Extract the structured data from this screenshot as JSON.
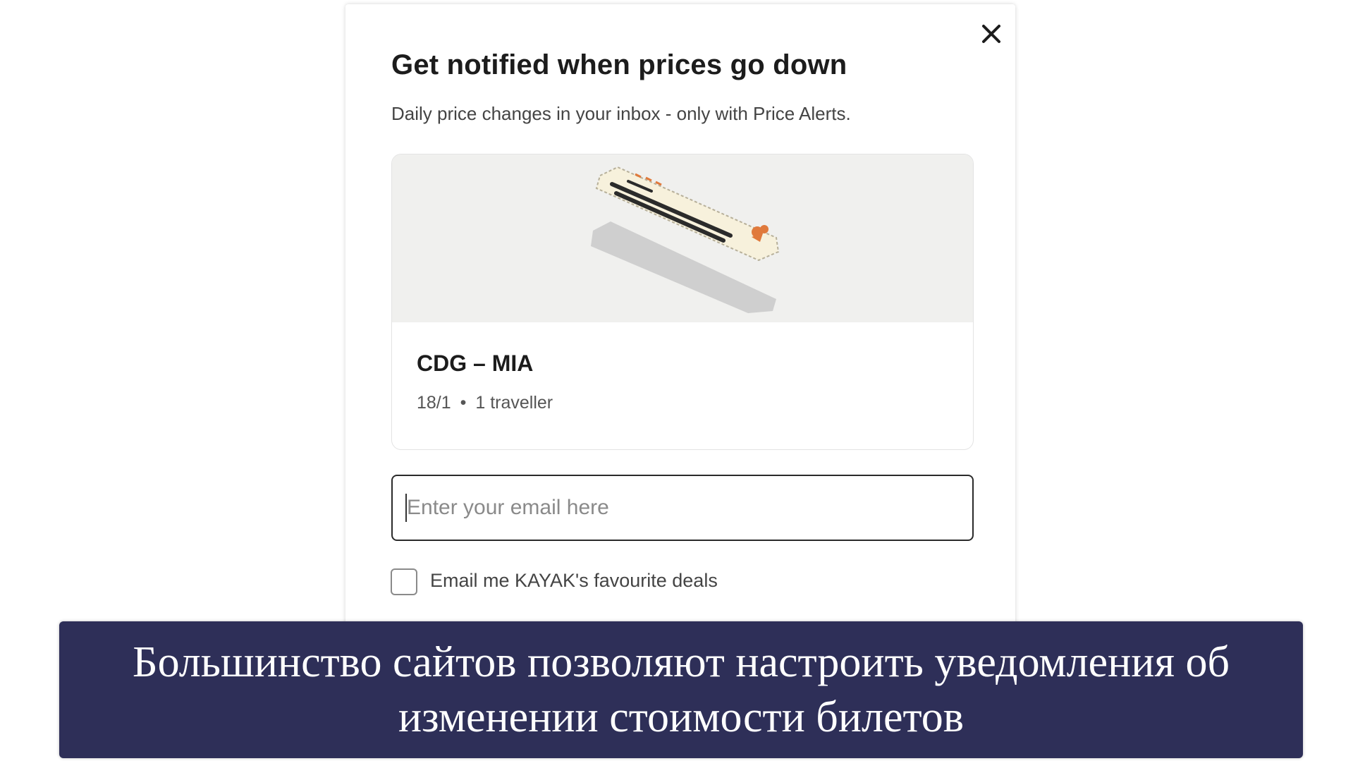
{
  "dialog": {
    "close_icon": "close-icon",
    "title": "Get notified when prices go down",
    "subtitle": "Daily price changes in your inbox - only with Price Alerts.",
    "trip": {
      "illustration_icon": "ticket-illustration",
      "route": "CDG – MIA",
      "date": "18/1",
      "separator": "•",
      "travellers": "1 traveller"
    },
    "email": {
      "value": "",
      "placeholder": "Enter your email here"
    },
    "deals_checkbox": {
      "checked": false,
      "label": "Email me KAYAK's favourite deals"
    }
  },
  "caption": {
    "text": "Большинство сайтов позволяют настроить уведомления об изменении стоимости билетов"
  },
  "colors": {
    "caption_background": "#2e2f58",
    "illustration_background": "#f0f0ee",
    "ticket_accent": "#e07a3c"
  }
}
